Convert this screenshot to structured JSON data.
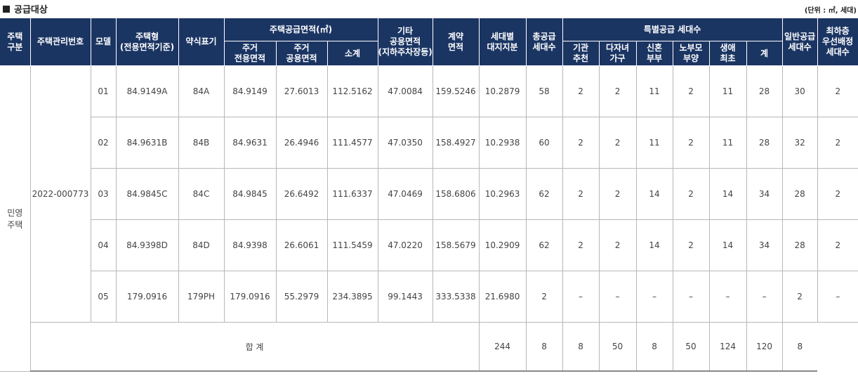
{
  "header": {
    "title": "공급대상",
    "unit": "(단위 : ㎡, 세대)"
  },
  "columns": {
    "type_top": "주택",
    "type_bottom": "구분",
    "mgmt_no": "주택관리번호",
    "model": "모델",
    "house_type_top": "주택형",
    "house_type_bottom": "(전용면적기준)",
    "short_label": "약식표기",
    "supply_area": "주택공급면적(㎡)",
    "exclusive_top": "주거",
    "exclusive_bottom": "전용면적",
    "common_top": "주거",
    "common_bottom": "공용면적",
    "subtotal": "소계",
    "other_l1": "기타",
    "other_l2": "공용면적",
    "other_l3": "(지하주차장등)",
    "contract_top": "계약",
    "contract_bottom": "면적",
    "land_top": "세대별",
    "land_bottom": "대지지분",
    "total_supply_top": "총공급",
    "total_supply_bottom": "세대수",
    "special": "특별공급 세대수",
    "inst_top": "기관",
    "inst_bottom": "추천",
    "multi_top": "다자녀",
    "multi_bottom": "가구",
    "newlywed_top": "신혼",
    "newlywed_bottom": "부부",
    "elderly_top": "노부모",
    "elderly_bottom": "부양",
    "first_top": "생애",
    "first_bottom": "최초",
    "sum": "계",
    "general_top": "일반공급",
    "general_bottom": "세대수",
    "low_l1": "최하층",
    "low_l2": "우선배정",
    "low_l3": "세대수"
  },
  "category": {
    "top": "민영",
    "bottom": "주택"
  },
  "mgmt_no": "2022-000773",
  "rows": [
    {
      "model": "01",
      "house_type": "84.9149A",
      "short": "84A",
      "exclusive": "84.9149",
      "common": "27.6013",
      "subtotal": "112.5162",
      "other": "47.0084",
      "contract": "159.5246",
      "land": "10.2879",
      "total": "58",
      "inst": "2",
      "multi": "2",
      "newlywed": "11",
      "elderly": "2",
      "first": "11",
      "sum": "28",
      "general": "30",
      "low": "2"
    },
    {
      "model": "02",
      "house_type": "84.9631B",
      "short": "84B",
      "exclusive": "84.9631",
      "common": "26.4946",
      "subtotal": "111.4577",
      "other": "47.0350",
      "contract": "158.4927",
      "land": "10.2938",
      "total": "60",
      "inst": "2",
      "multi": "2",
      "newlywed": "11",
      "elderly": "2",
      "first": "11",
      "sum": "28",
      "general": "32",
      "low": "2"
    },
    {
      "model": "03",
      "house_type": "84.9845C",
      "short": "84C",
      "exclusive": "84.9845",
      "common": "26.6492",
      "subtotal": "111.6337",
      "other": "47.0469",
      "contract": "158.6806",
      "land": "10.2963",
      "total": "62",
      "inst": "2",
      "multi": "2",
      "newlywed": "14",
      "elderly": "2",
      "first": "14",
      "sum": "34",
      "general": "28",
      "low": "2"
    },
    {
      "model": "04",
      "house_type": "84.9398D",
      "short": "84D",
      "exclusive": "84.9398",
      "common": "26.6061",
      "subtotal": "111.5459",
      "other": "47.0220",
      "contract": "158.5679",
      "land": "10.2909",
      "total": "62",
      "inst": "2",
      "multi": "2",
      "newlywed": "14",
      "elderly": "2",
      "first": "14",
      "sum": "34",
      "general": "28",
      "low": "2"
    },
    {
      "model": "05",
      "house_type": "179.0916",
      "short": "179PH",
      "exclusive": "179.0916",
      "common": "55.2979",
      "subtotal": "234.3895",
      "other": "99.1443",
      "contract": "333.5338",
      "land": "21.6980",
      "total": "2",
      "inst": "–",
      "multi": "–",
      "newlywed": "–",
      "elderly": "–",
      "first": "–",
      "sum": "–",
      "general": "2",
      "low": "–"
    }
  ],
  "total": {
    "label": "합 계",
    "total": "244",
    "inst": "8",
    "multi": "8",
    "newlywed": "50",
    "elderly": "8",
    "first": "50",
    "sum": "124",
    "general": "120",
    "low": "8"
  }
}
